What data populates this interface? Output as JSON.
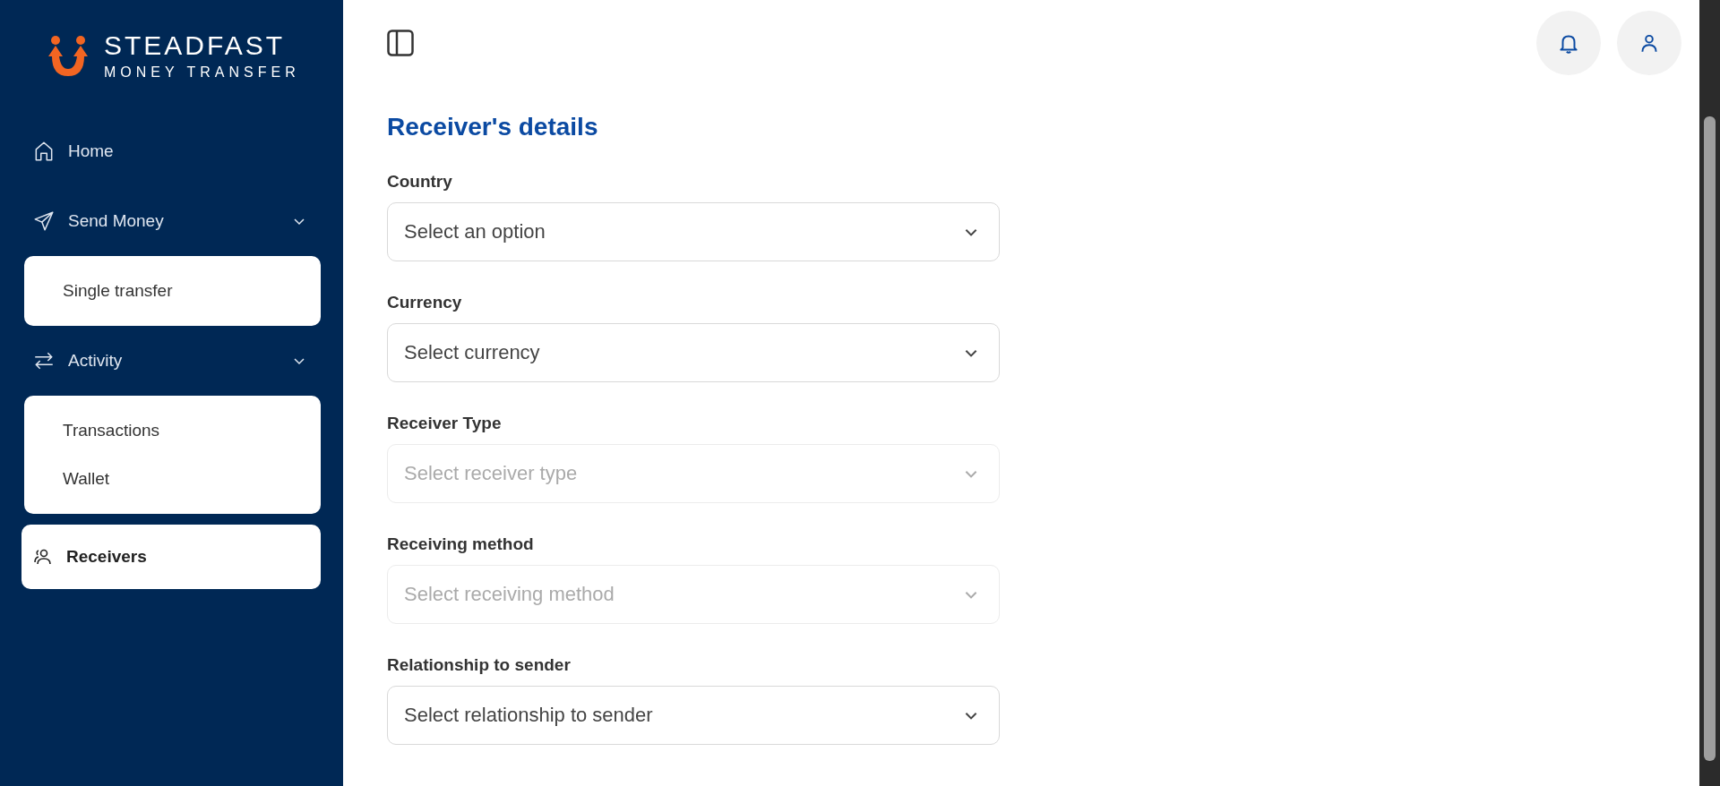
{
  "brand": {
    "name": "STEADFAST",
    "tagline": "MONEY TRANSFER"
  },
  "sidebar": {
    "items": [
      {
        "kind": "link",
        "label": "Home",
        "selected": false
      },
      {
        "kind": "group",
        "label": "Send Money",
        "expanded": true,
        "selected": false,
        "children": [
          {
            "label": "Single transfer",
            "selected": false
          }
        ]
      },
      {
        "kind": "group",
        "label": "Activity",
        "expanded": true,
        "selected": false,
        "children": [
          {
            "label": "Transactions",
            "selected": false
          },
          {
            "label": "Wallet",
            "selected": false
          }
        ]
      },
      {
        "kind": "link",
        "label": "Receivers",
        "selected": true
      }
    ]
  },
  "form": {
    "title": "Receiver's details",
    "fields": [
      {
        "label": "Country",
        "placeholder": "Select an option",
        "disabled": false
      },
      {
        "label": "Currency",
        "placeholder": "Select currency",
        "disabled": false
      },
      {
        "label": "Receiver Type",
        "placeholder": "Select receiver type",
        "disabled": true
      },
      {
        "label": "Receiving method",
        "placeholder": "Select receiving method",
        "disabled": true
      },
      {
        "label": "Relationship to sender",
        "placeholder": "Select relationship to sender",
        "disabled": false
      }
    ]
  }
}
